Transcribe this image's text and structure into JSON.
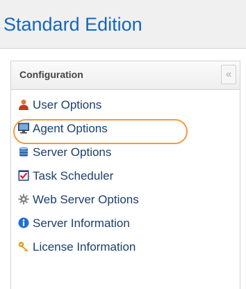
{
  "header": {
    "title": "Standard Edition"
  },
  "panel": {
    "title": "Configuration",
    "collapse_label": "«",
    "highlighted_item": "Agent Options",
    "highlight_color": "#f39a3a"
  },
  "menu": {
    "items": [
      {
        "label": "User Options",
        "icon": "user-icon"
      },
      {
        "label": "Agent Options",
        "icon": "monitor-icon"
      },
      {
        "label": "Server Options",
        "icon": "database-icon"
      },
      {
        "label": "Task Scheduler",
        "icon": "checkbox-calendar-icon"
      },
      {
        "label": "Web Server Options",
        "icon": "gear-icon"
      },
      {
        "label": "Server Information",
        "icon": "info-icon"
      },
      {
        "label": "License Information",
        "icon": "key-icon"
      }
    ]
  },
  "colors": {
    "title": "#1667b8",
    "link": "#1a3f6d",
    "panel_border": "#c9d5e3"
  }
}
